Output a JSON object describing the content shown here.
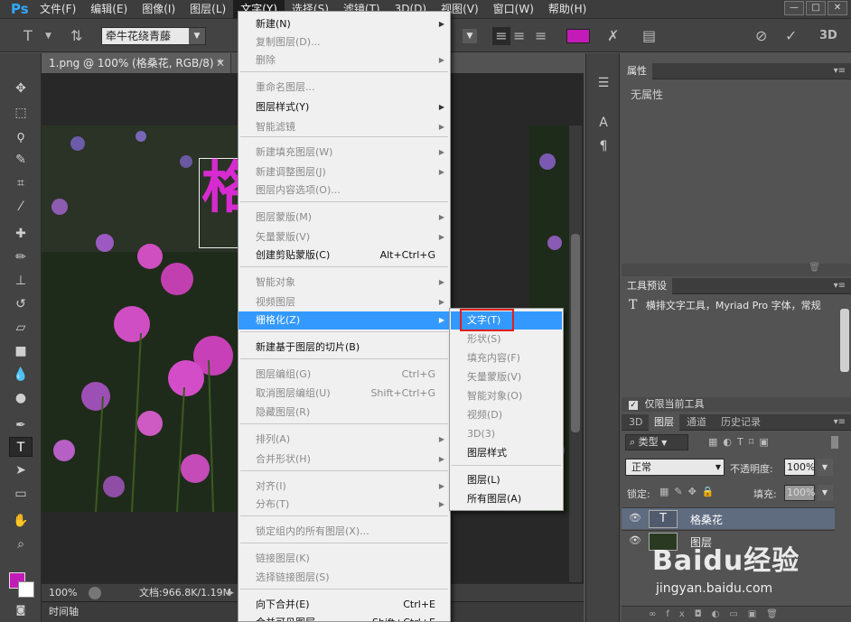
{
  "menubar": {
    "logo": "Ps",
    "items": [
      "文件(F)",
      "编辑(E)",
      "图像(I)",
      "图层(L)",
      "文字(Y)",
      "选择(S)",
      "滤镜(T)",
      "3D(D)",
      "视图(V)",
      "窗口(W)",
      "帮助(H)"
    ],
    "active_index": 4,
    "window_controls": [
      "—",
      "□",
      "✕"
    ]
  },
  "options": {
    "font_family": "牵牛花绕青藤",
    "color": "#c31bb8",
    "three_d": "3D"
  },
  "document": {
    "tab_title": "1.png @ 100% (格桑花, RGB/8) *",
    "canvas_text": "格",
    "zoom": "100%",
    "doc_info": "文档:966.8K/1.19M",
    "timeline_label": "时间轴"
  },
  "layer_menu": {
    "items": [
      {
        "label": "新建(N)",
        "submenu": true
      },
      {
        "label": "复制图层(D)...",
        "disabled": true
      },
      {
        "label": "删除",
        "disabled": true,
        "submenu": true
      },
      {
        "label": "重命名图层...",
        "disabled": true
      },
      {
        "label": "图层样式(Y)",
        "submenu": true
      },
      {
        "label": "智能滤镜",
        "disabled": true,
        "submenu": true
      },
      {
        "label": "新建填充图层(W)",
        "disabled": true,
        "submenu": true
      },
      {
        "label": "新建调整图层(J)",
        "disabled": true,
        "submenu": true
      },
      {
        "label": "图层内容选项(O)...",
        "disabled": true
      },
      {
        "label": "图层蒙版(M)",
        "disabled": true,
        "submenu": true
      },
      {
        "label": "矢量蒙版(V)",
        "disabled": true,
        "submenu": true
      },
      {
        "label": "创建剪贴蒙版(C)",
        "shortcut": "Alt+Ctrl+G"
      },
      {
        "label": "智能对象",
        "disabled": true,
        "submenu": true
      },
      {
        "label": "视频图层",
        "disabled": true,
        "submenu": true
      },
      {
        "label": "栅格化(Z)",
        "submenu": true,
        "highlight": true
      },
      {
        "label": "新建基于图层的切片(B)"
      },
      {
        "label": "图层编组(G)",
        "disabled": true,
        "shortcut": "Ctrl+G"
      },
      {
        "label": "取消图层编组(U)",
        "disabled": true,
        "shortcut": "Shift+Ctrl+G"
      },
      {
        "label": "隐藏图层(R)",
        "disabled": true
      },
      {
        "label": "排列(A)",
        "disabled": true,
        "submenu": true
      },
      {
        "label": "合并形状(H)",
        "disabled": true,
        "submenu": true
      },
      {
        "label": "对齐(I)",
        "disabled": true,
        "submenu": true
      },
      {
        "label": "分布(T)",
        "disabled": true,
        "submenu": true
      },
      {
        "label": "锁定组内的所有图层(X)...",
        "disabled": true
      },
      {
        "label": "链接图层(K)",
        "disabled": true
      },
      {
        "label": "选择链接图层(S)",
        "disabled": true
      },
      {
        "label": "向下合并(E)",
        "shortcut": "Ctrl+E"
      },
      {
        "label": "合并可见图层",
        "shortcut": "Shift+Ctrl+E"
      }
    ]
  },
  "rasterize_submenu": {
    "items": [
      {
        "label": "文字(T)",
        "highlight": true
      },
      {
        "label": "形状(S)",
        "disabled": true
      },
      {
        "label": "填充内容(F)",
        "disabled": true
      },
      {
        "label": "矢量蒙版(V)",
        "disabled": true
      },
      {
        "label": "智能对象(O)",
        "disabled": true
      },
      {
        "label": "视频(D)",
        "disabled": true
      },
      {
        "label": "3D(3)",
        "disabled": true
      },
      {
        "label": "图层样式"
      },
      {
        "label": "图层(L)"
      },
      {
        "label": "所有图层(A)"
      }
    ]
  },
  "properties_panel": {
    "tab": "属性",
    "empty_text": "无属性"
  },
  "tool_presets_panel": {
    "tab": "工具预设",
    "preset": "横排文字工具，Myriad Pro 字体，常规",
    "current_only": "仅限当前工具"
  },
  "layers_panel": {
    "tabs": [
      "3D",
      "图层",
      "通道",
      "历史记录"
    ],
    "active_tab": 1,
    "filter_label": "类型",
    "blend_mode": "正常",
    "opacity_label": "不透明度:",
    "opacity_value": "100%",
    "lock_label": "锁定:",
    "fill_label": "填充:",
    "fill_value": "100%",
    "layers": [
      {
        "name": "格桑花",
        "kind": "text",
        "selected": true
      },
      {
        "name": "图层",
        "kind": "image",
        "selected": false
      }
    ]
  },
  "watermark": {
    "logo": "Baidu经验",
    "url": "jingyan.baidu.com"
  }
}
